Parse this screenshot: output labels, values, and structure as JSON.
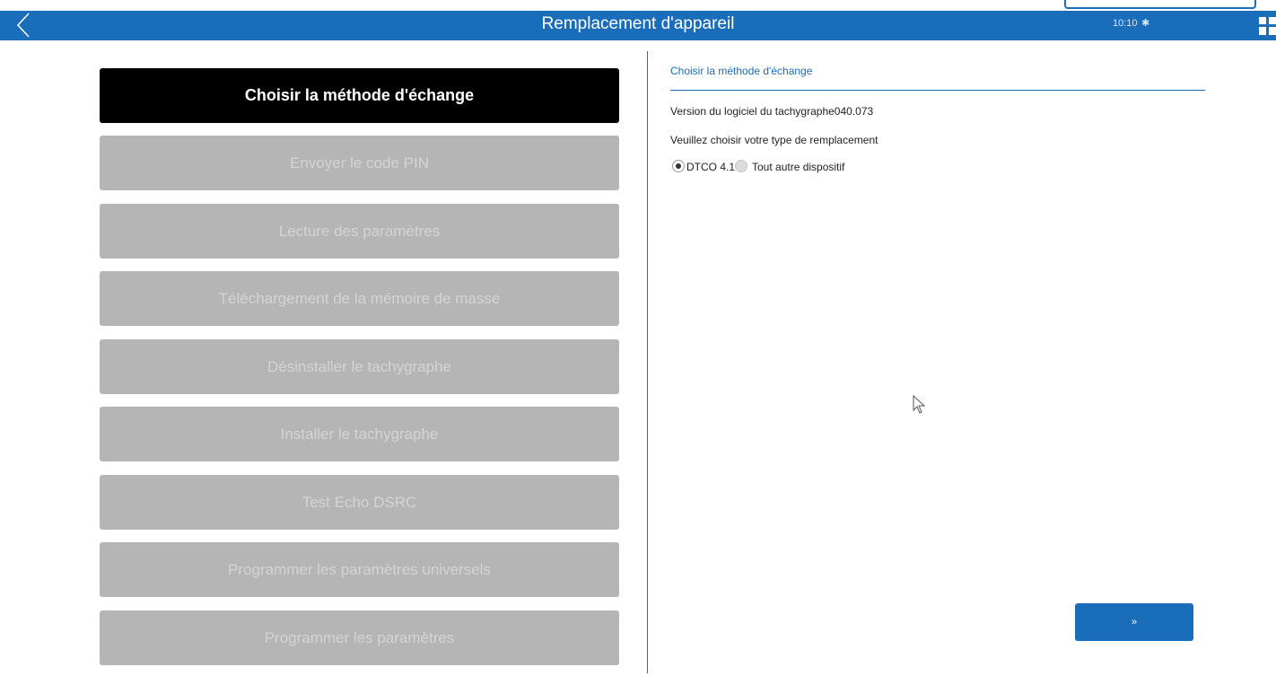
{
  "header": {
    "title": "Remplacement d'appareil",
    "time": "10:10",
    "bluetooth_icon": "bluetooth-icon",
    "back_icon": "chevron-left-icon",
    "corner_icon": "grid-icon",
    "background_color": "#1a6db8"
  },
  "menu": {
    "items": [
      {
        "label": "Choisir la méthode d'échange",
        "active": true
      },
      {
        "label": "Envoyer le code PIN",
        "active": false
      },
      {
        "label": "Lecture des paramètres",
        "active": false
      },
      {
        "label": "Téléchargement de la mémoire de masse",
        "active": false
      },
      {
        "label": "Désinstaller le tachygraphe",
        "active": false
      },
      {
        "label": "Installer le tachygraphe",
        "active": false
      },
      {
        "label": "Test Echo DSRC",
        "active": false
      },
      {
        "label": "Programmer les paramètres universels",
        "active": false
      },
      {
        "label": "Programmer les paramètres",
        "active": false
      }
    ]
  },
  "panel": {
    "title": "Choisir la méthode d'échange",
    "version_label": "Version du logiciel du tachygraphe",
    "version_value": "040.073",
    "choose_label": "Veuillez choisir votre type de remplacement",
    "options": [
      {
        "label": "DTCO 4.1",
        "selected": true
      },
      {
        "label": "Tout autre dispositif",
        "selected": false
      }
    ],
    "next_label": "»"
  },
  "colors": {
    "accent": "#1a6db8",
    "active_item": "#000000",
    "disabled_item": "#b5b5b5",
    "disabled_text": "#d4d4d4"
  }
}
